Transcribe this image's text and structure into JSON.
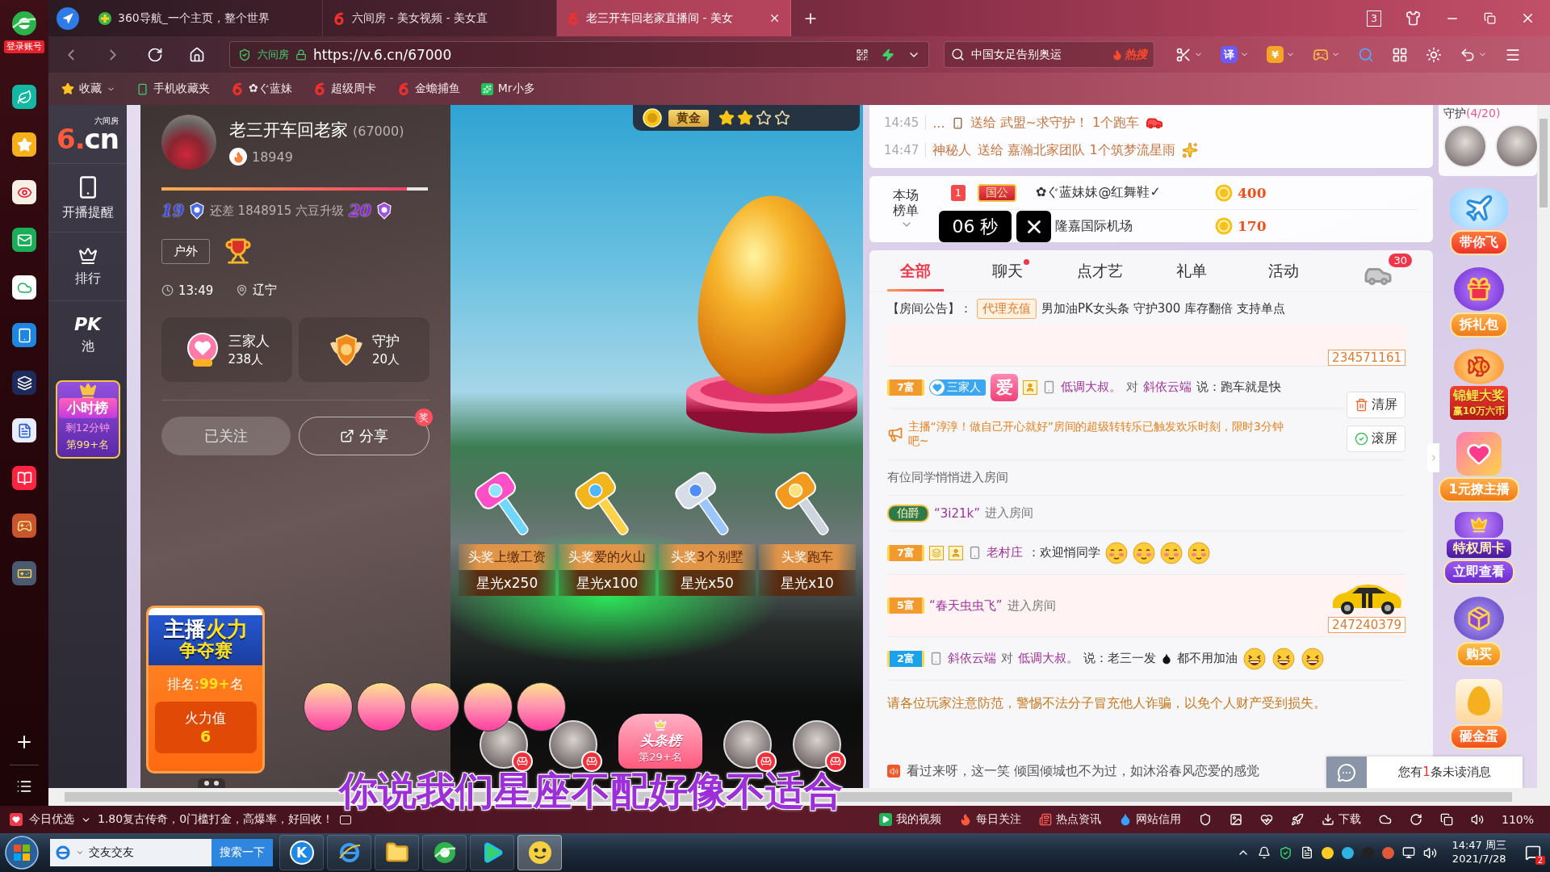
{
  "desktop_sidebar": {
    "account_label": "登录账号"
  },
  "browser": {
    "tabs": [
      {
        "title": "360导航_一个主页，整个世界",
        "kind": "nav360",
        "selected": false
      },
      {
        "title": "六间房 - 美女视频 - 美女直",
        "kind": "six",
        "selected": false
      },
      {
        "title": "老三开车回老家直播间 - 美女",
        "kind": "six",
        "selected": true
      }
    ],
    "window_count": "3",
    "address": {
      "site_label": "六间房",
      "url": "https://v.6.cn/67000"
    },
    "search": {
      "value": "中国女足告别奥运",
      "hot_label": "热搜"
    },
    "translate_label": "译",
    "coin_label": "¥",
    "bookmarks": [
      {
        "kind": "folder",
        "label": "收藏"
      },
      {
        "kind": "phone",
        "label": "手机收藏夹"
      },
      {
        "kind": "site",
        "label": "✿ぐ蓝妹"
      },
      {
        "kind": "site",
        "label": "超级周卡"
      },
      {
        "kind": "site",
        "label": "金蟾捕鱼"
      },
      {
        "kind": "app",
        "label": "Mr小多"
      }
    ]
  },
  "site_nav": {
    "logo": "6.cn",
    "logo_caption": "六间房",
    "items": [
      {
        "kind": "phone",
        "label": "开播提醒"
      },
      {
        "kind": "crown",
        "label": "排行"
      },
      {
        "kind": "pk",
        "mark": "PK",
        "label": "池"
      }
    ],
    "hour_rank": {
      "title": "小时榜",
      "time_left": "剩12分钟",
      "rank": "第99+名"
    }
  },
  "streamer": {
    "name": "老三开车回老家",
    "room_id": "(67000)",
    "popularity": "18949",
    "upgrade_bar": {
      "level": 0.92
    },
    "level_from": "19",
    "upgrade_note": "还差 1848915 六豆升级",
    "level_to": "20",
    "category": "户外",
    "time": "13:49",
    "location": "辽宁",
    "stats": [
      {
        "kind": "fans",
        "label": "三家人",
        "value": "238人"
      },
      {
        "kind": "guard",
        "label": "守护",
        "value": "20人"
      }
    ],
    "follow_button": {
      "label": "已关注",
      "followed": true
    },
    "share_button": {
      "label": "分享",
      "badge": "奖"
    }
  },
  "fire_contest": {
    "title_a": "主播",
    "title_b": "火力",
    "title_c": "争夺赛",
    "rank_label": "排名:",
    "rank_value": "99+",
    "rank_suffix": "名",
    "score_label": "火力值",
    "score": "6"
  },
  "video": {
    "rank_badge": {
      "label": "黄金",
      "stars": 2
    },
    "prizes": [
      {
        "kind": "pink",
        "head": "头奖",
        "name": "上缴工资",
        "reward": "星光x250"
      },
      {
        "kind": "gold",
        "head": "头奖",
        "name": "爱的火山",
        "reward": "星光x100"
      },
      {
        "kind": "silver",
        "head": "头奖",
        "name": "3个别墅",
        "reward": "星光x50"
      },
      {
        "kind": "orange",
        "head": "头奖",
        "name": "跑车",
        "reward": "星光x10"
      }
    ],
    "headline_rank": {
      "title": "头条榜",
      "rank": "第29+名"
    }
  },
  "chat": {
    "gift_feed": [
      {
        "time": "14:45",
        "sender": "...",
        "mobile": true,
        "text": "送给 武盟~求守护！ 1个跑车",
        "kind": "car"
      },
      {
        "time": "14:47",
        "sender": "神秘人",
        "mobile": false,
        "text": "送给 嘉瀚北家团队 1个筑梦流星雨",
        "kind": "meteor"
      }
    ],
    "ranking": {
      "title": "本场榜单",
      "rows": [
        {
          "rank": "1",
          "badge": "国公",
          "name": "✿ぐ蓝妹妹@红舞鞋✓",
          "score": "400"
        },
        {
          "name": "隆嘉国际机场",
          "score": "170"
        }
      ],
      "countdown": "06 秒"
    },
    "tabs": [
      {
        "label": "全部",
        "selected": true,
        "dot": false
      },
      {
        "label": "聊天",
        "selected": false,
        "dot": true
      },
      {
        "label": "点才艺",
        "selected": false,
        "dot": false
      },
      {
        "label": "礼单",
        "selected": false,
        "dot": false
      },
      {
        "label": "活动",
        "selected": false,
        "dot": false
      }
    ],
    "car_count": "30",
    "notice": {
      "label": "【房间公告】：",
      "tag": "代理充值",
      "text": "男加油PK女头条 守护300 库存翻倍 支持单点"
    },
    "messages": [
      {
        "kind": "id_tail",
        "id_number": "234571161",
        "highlight": true
      },
      {
        "kind": "chat",
        "wealth": {
          "label": "7富",
          "color": "#f39a2e"
        },
        "fan_badge": "三家人",
        "love_badge": "爱",
        "user_icon": true,
        "mobile": true,
        "from": "低调大叔。",
        "to_word": "对",
        "to": "斜依云端",
        "text": "说：跑车就是快"
      },
      {
        "kind": "system",
        "text": "主播“淳淳！做自己开心就好”房间的超级转转乐已触发欢乐时刻，限时3分钟",
        "text_end": "吧~"
      },
      {
        "kind": "notice",
        "text": "有位同学悄悄进入房间"
      },
      {
        "kind": "entry",
        "noble": "伯爵",
        "name": "“3i21k”",
        "text": "进入房间"
      },
      {
        "kind": "chat",
        "wealth": {
          "label": "7富",
          "color": "#f39a2e"
        },
        "gold_icon": true,
        "user_icon": true,
        "mobile": true,
        "from": "老村庄",
        "text": "：欢迎悄同学",
        "emojis": [
          {
            "kind": "shy"
          },
          {
            "kind": "shy"
          },
          {
            "kind": "shy"
          },
          {
            "kind": "shy"
          }
        ]
      },
      {
        "kind": "entry",
        "wealth": {
          "label": "5富",
          "color": "#f39a2e"
        },
        "name": "“春天虫虫飞”",
        "text": "进入房间",
        "car": true,
        "id_number": "247240379",
        "highlight": true
      },
      {
        "kind": "chat",
        "wealth": {
          "label": "2富",
          "color": "#1aa3ea"
        },
        "mobile": true,
        "from": "斜依云端",
        "to_word": "对",
        "to": "低调大叔。",
        "text": "说：老三一发",
        "drop_icon": true,
        "text_after": "都不用加油",
        "emojis": [
          {
            "kind": "laugh"
          },
          {
            "kind": "laugh"
          },
          {
            "kind": "laugh"
          }
        ]
      }
    ],
    "controls": [
      {
        "kind": "clear",
        "label": "清屏"
      },
      {
        "kind": "scroll",
        "label": "滚屏"
      }
    ],
    "warning": "请各位玩家注意防范，警惕不法分子冒充他人诈骗，以免个人财产受到损失。",
    "marquee": "看过来呀，这一笑 倾国倾城也不为过，如沐浴春风恋爱的感觉",
    "unread": {
      "prefix": "您有",
      "count": "1",
      "suffix": "条未读消息"
    }
  },
  "side_column": {
    "guard_title": "守护",
    "guard_count": "(4/20)",
    "promos": [
      {
        "kind": "plane",
        "label": "带你飞"
      },
      {
        "kind": "gift",
        "label": "拆礼包"
      },
      {
        "kind": "koi",
        "label": "锦鲤大奖",
        "sub": "赢10万六币"
      },
      {
        "kind": "heart",
        "label": "1元撩主播"
      },
      {
        "kind": "card",
        "label": "特权周卡",
        "sub": "立即查看"
      },
      {
        "kind": "chest",
        "label": "购买"
      },
      {
        "kind": "egg",
        "label": "砸金蛋"
      }
    ]
  },
  "desktop_lyrics": "你说我们星座不配好像不适合",
  "status_bar": {
    "pick_label": "今日优选",
    "promo": "1.80复古传奇，0门槛打金，高爆率，好回收！",
    "links": [
      {
        "kind": "video",
        "label": "我的视频"
      },
      {
        "kind": "fire",
        "label": "每日关注"
      },
      {
        "kind": "news",
        "label": "热点资讯"
      },
      {
        "kind": "credit",
        "label": "网站信用"
      },
      {
        "kind": "download",
        "label": "下载"
      }
    ],
    "zoom": "110%"
  },
  "taskbar": {
    "search_value": "交友交友",
    "search_button": "搜索一下",
    "app_logo_letter": "K",
    "time": "14:47 周三",
    "date": "2021/7/28",
    "notification_count": "2"
  }
}
